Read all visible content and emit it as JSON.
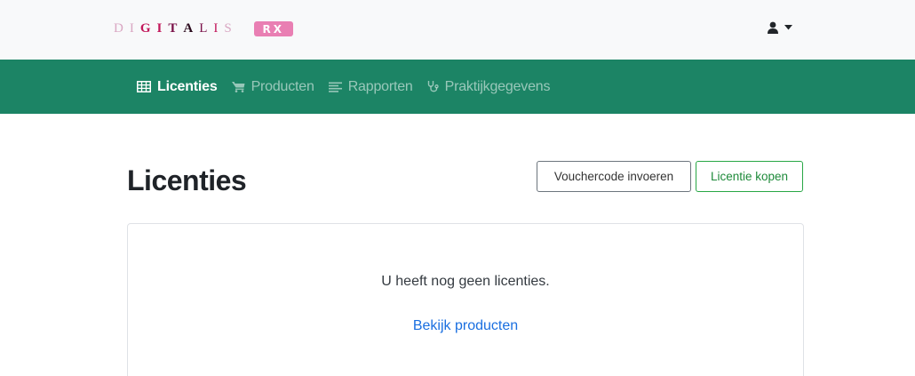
{
  "brand": {
    "letters": [
      {
        "char": "D",
        "color": "#d9a7c2",
        "bold": false
      },
      {
        "char": "I",
        "color": "#d9a7c2",
        "bold": false
      },
      {
        "char": "G",
        "color": "#c2185b",
        "bold": true
      },
      {
        "char": "I",
        "color": "#c2185b",
        "bold": true
      },
      {
        "char": "T",
        "color": "#7a1148",
        "bold": true
      },
      {
        "char": "A",
        "color": "#2a0a1c",
        "bold": true
      },
      {
        "char": "L",
        "color": "#7a1148",
        "bold": false
      },
      {
        "char": "I",
        "color": "#c2185b",
        "bold": false
      },
      {
        "char": "S",
        "color": "#d9a7c2",
        "bold": false
      }
    ],
    "badge": "RX",
    "badge_color": "#e97fb3"
  },
  "user_menu": {
    "icon": "user-icon",
    "caret": "caret-down-icon"
  },
  "nav": {
    "items": [
      {
        "label": "Licenties",
        "icon": "table-icon",
        "active": true
      },
      {
        "label": "Producten",
        "icon": "cart-icon",
        "active": false
      },
      {
        "label": "Rapporten",
        "icon": "list-icon",
        "active": false
      },
      {
        "label": "Praktijkgegevens",
        "icon": "stethoscope-icon",
        "active": false
      }
    ],
    "background": "#1c8465"
  },
  "page": {
    "title": "Licenties",
    "voucher_button": "Vouchercode invoeren",
    "buy_button": "Licentie kopen"
  },
  "card": {
    "empty_message": "U heeft nog geen licenties.",
    "products_link": "Bekijk producten"
  }
}
